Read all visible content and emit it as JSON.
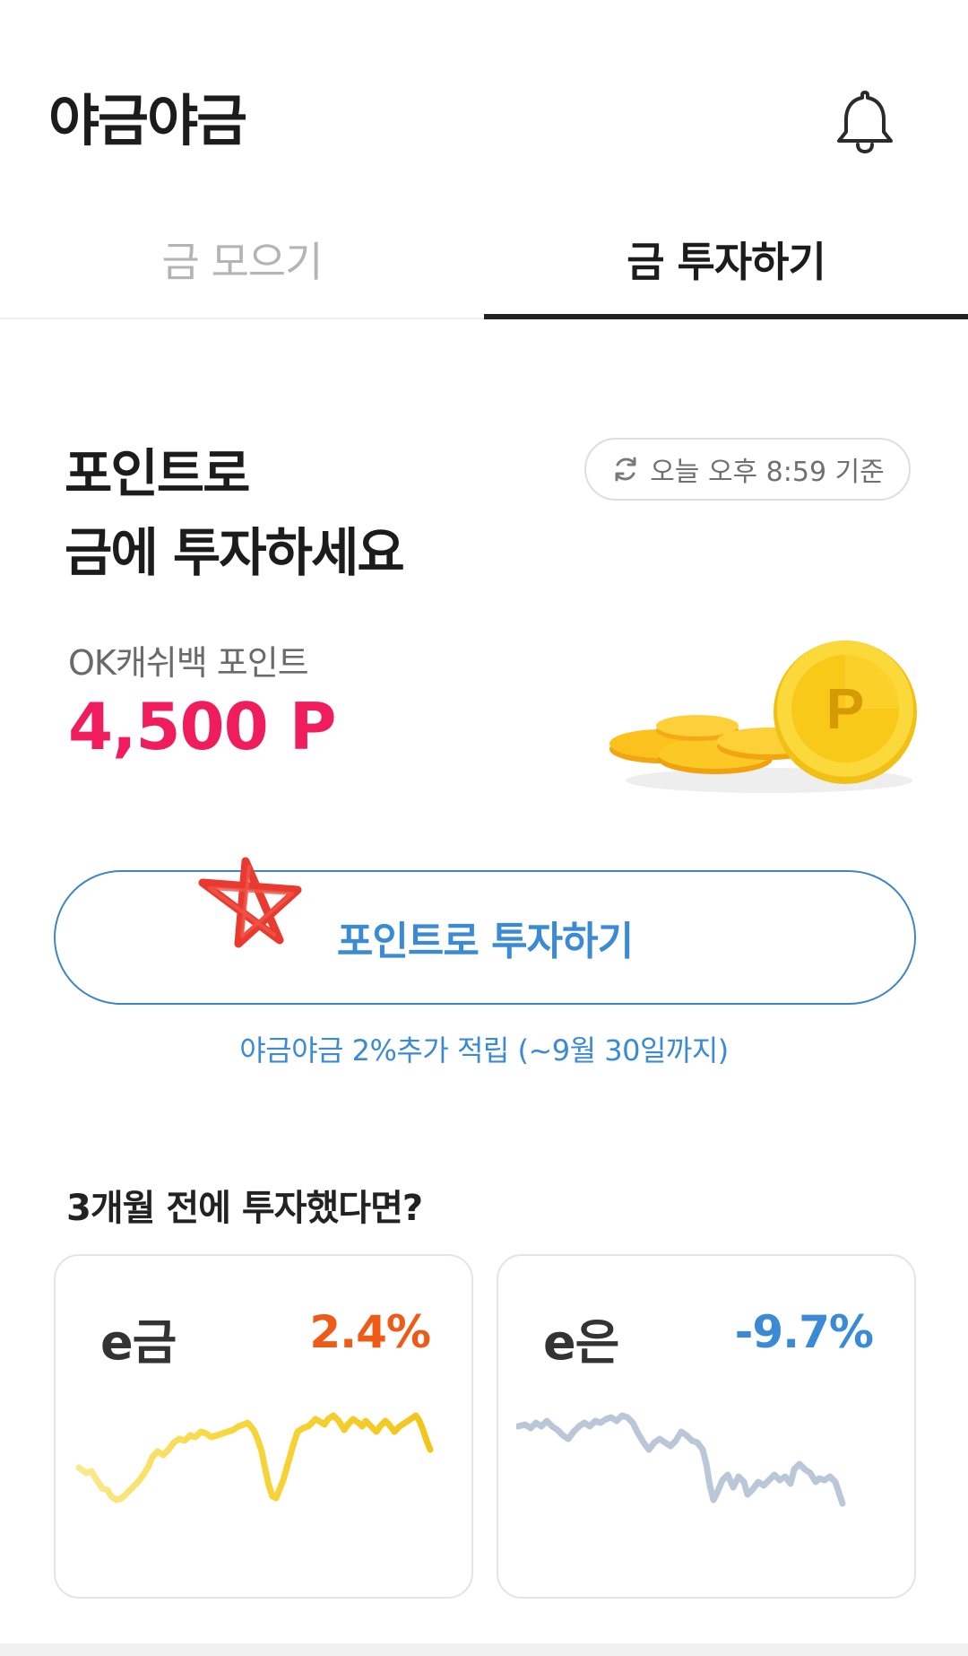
{
  "header": {
    "title": "야금야금",
    "bell_icon": "bell-icon"
  },
  "tabs": [
    {
      "label": "금 모으기",
      "active": false
    },
    {
      "label": "금 투자하기",
      "active": true
    }
  ],
  "main": {
    "headline_line1": "포인트로",
    "headline_line2": "금에 투자하세요",
    "timestamp": "오늘 오후 8:59 기준",
    "points_label": "OK캐쉬백 포인트",
    "points_value": "4,500 P",
    "coin_icon_letter": "P",
    "invest_button": "포인트로 투자하기",
    "promo_text": "야금야금 2%추가 적립 (~9월 30일까지)"
  },
  "section": {
    "title": "3개월 전에 투자했다면?",
    "cards": [
      {
        "name": "e금",
        "rate": "2.4%",
        "color": "#f5cf3a"
      },
      {
        "name": "e은",
        "rate": "-9.7%",
        "color": "#b8c6d8"
      }
    ]
  },
  "colors": {
    "accent_blue": "#3b8ad6",
    "points_pink": "#ef1d5e",
    "rate_up": "#ef5a17",
    "rate_down": "#3b8ad6"
  }
}
